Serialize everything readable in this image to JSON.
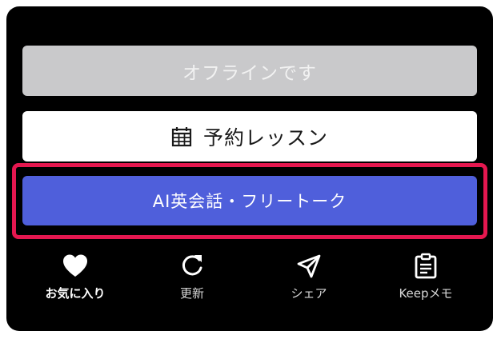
{
  "buttons": {
    "offline_label": "オフラインです",
    "reserve_label": "予約レッスン",
    "ai_label": "AI英会話・フリートーク"
  },
  "icons": {
    "reserve": "calendar-icon",
    "favorite": "heart-icon",
    "refresh": "refresh-icon",
    "share": "send-icon",
    "keep": "clipboard-icon"
  },
  "nav": {
    "items": [
      {
        "label": "お気に入り"
      },
      {
        "label": "更新"
      },
      {
        "label": "シェア"
      },
      {
        "label": "Keepメモ"
      }
    ]
  },
  "colors": {
    "panel": "#000000",
    "offline_bg": "#c9c9cb",
    "reserve_bg": "#ffffff",
    "ai_bg": "#4f5fdb",
    "highlight": "#e5174f"
  }
}
